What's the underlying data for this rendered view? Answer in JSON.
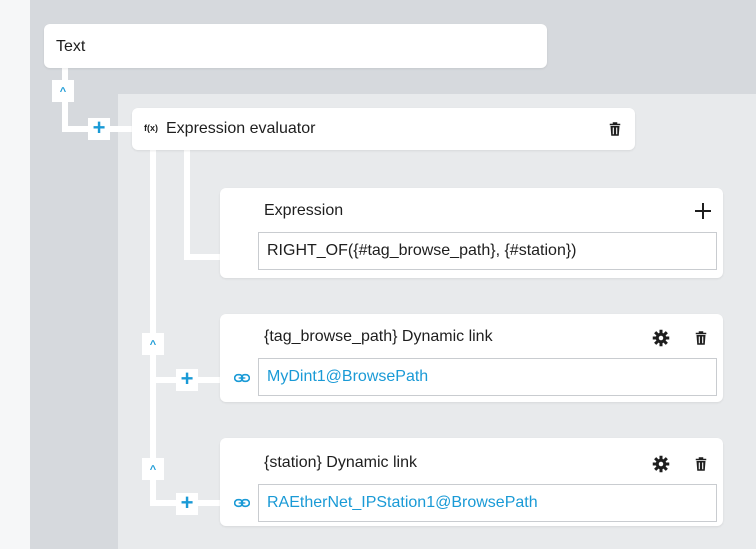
{
  "text_node": {
    "title": "Text"
  },
  "expr_eval": {
    "icon_label": "f(x)",
    "title": "Expression evaluator"
  },
  "expression": {
    "label": "Expression",
    "value": "RIGHT_OF({#tag_browse_path}, {#station})"
  },
  "link1": {
    "title": "{tag_browse_path} Dynamic link",
    "value": "MyDint1@BrowsePath"
  },
  "link2": {
    "title": "{station} Dynamic link",
    "value": "RAEtherNet_IPStation1@BrowsePath"
  },
  "glyphs": {
    "add": "+",
    "collapse": "^"
  },
  "colors": {
    "accent": "#1a9ad6",
    "canvas": "#d6d9dd",
    "inner": "#e8eaec"
  }
}
